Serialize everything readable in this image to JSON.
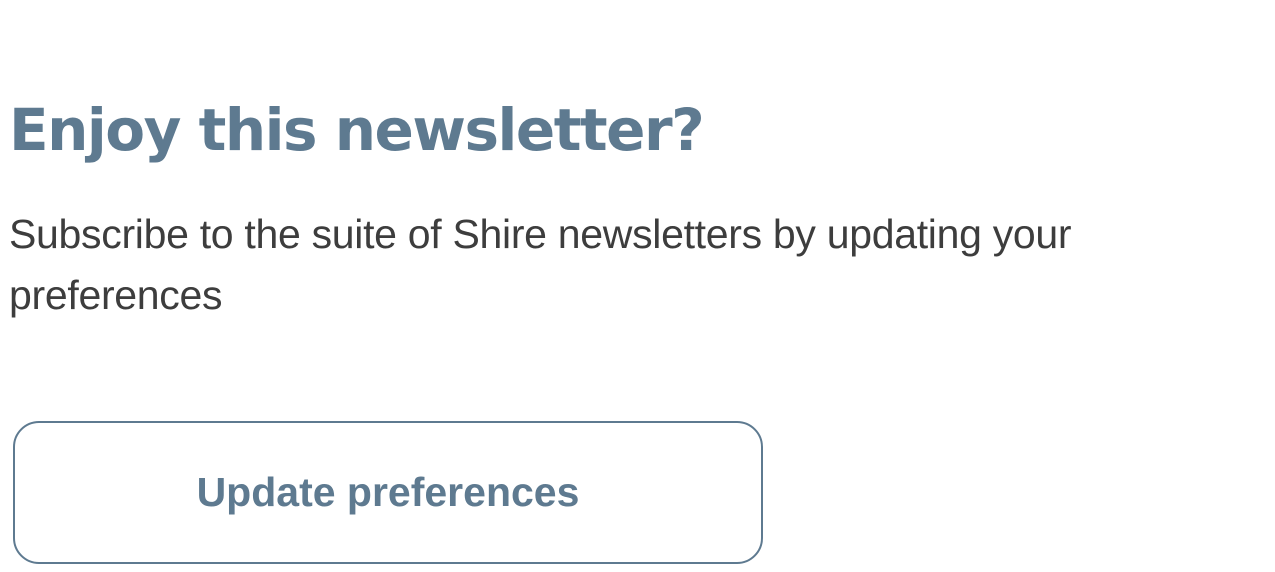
{
  "newsletter_promo": {
    "title": "Enjoy this newsletter?",
    "description": "Subscribe to the suite of Shire newsletters by updating your preferences",
    "button_label": "Update preferences"
  },
  "colors": {
    "accent": "#5e7a90",
    "body_text": "#3d3d3d",
    "background": "#ffffff"
  }
}
